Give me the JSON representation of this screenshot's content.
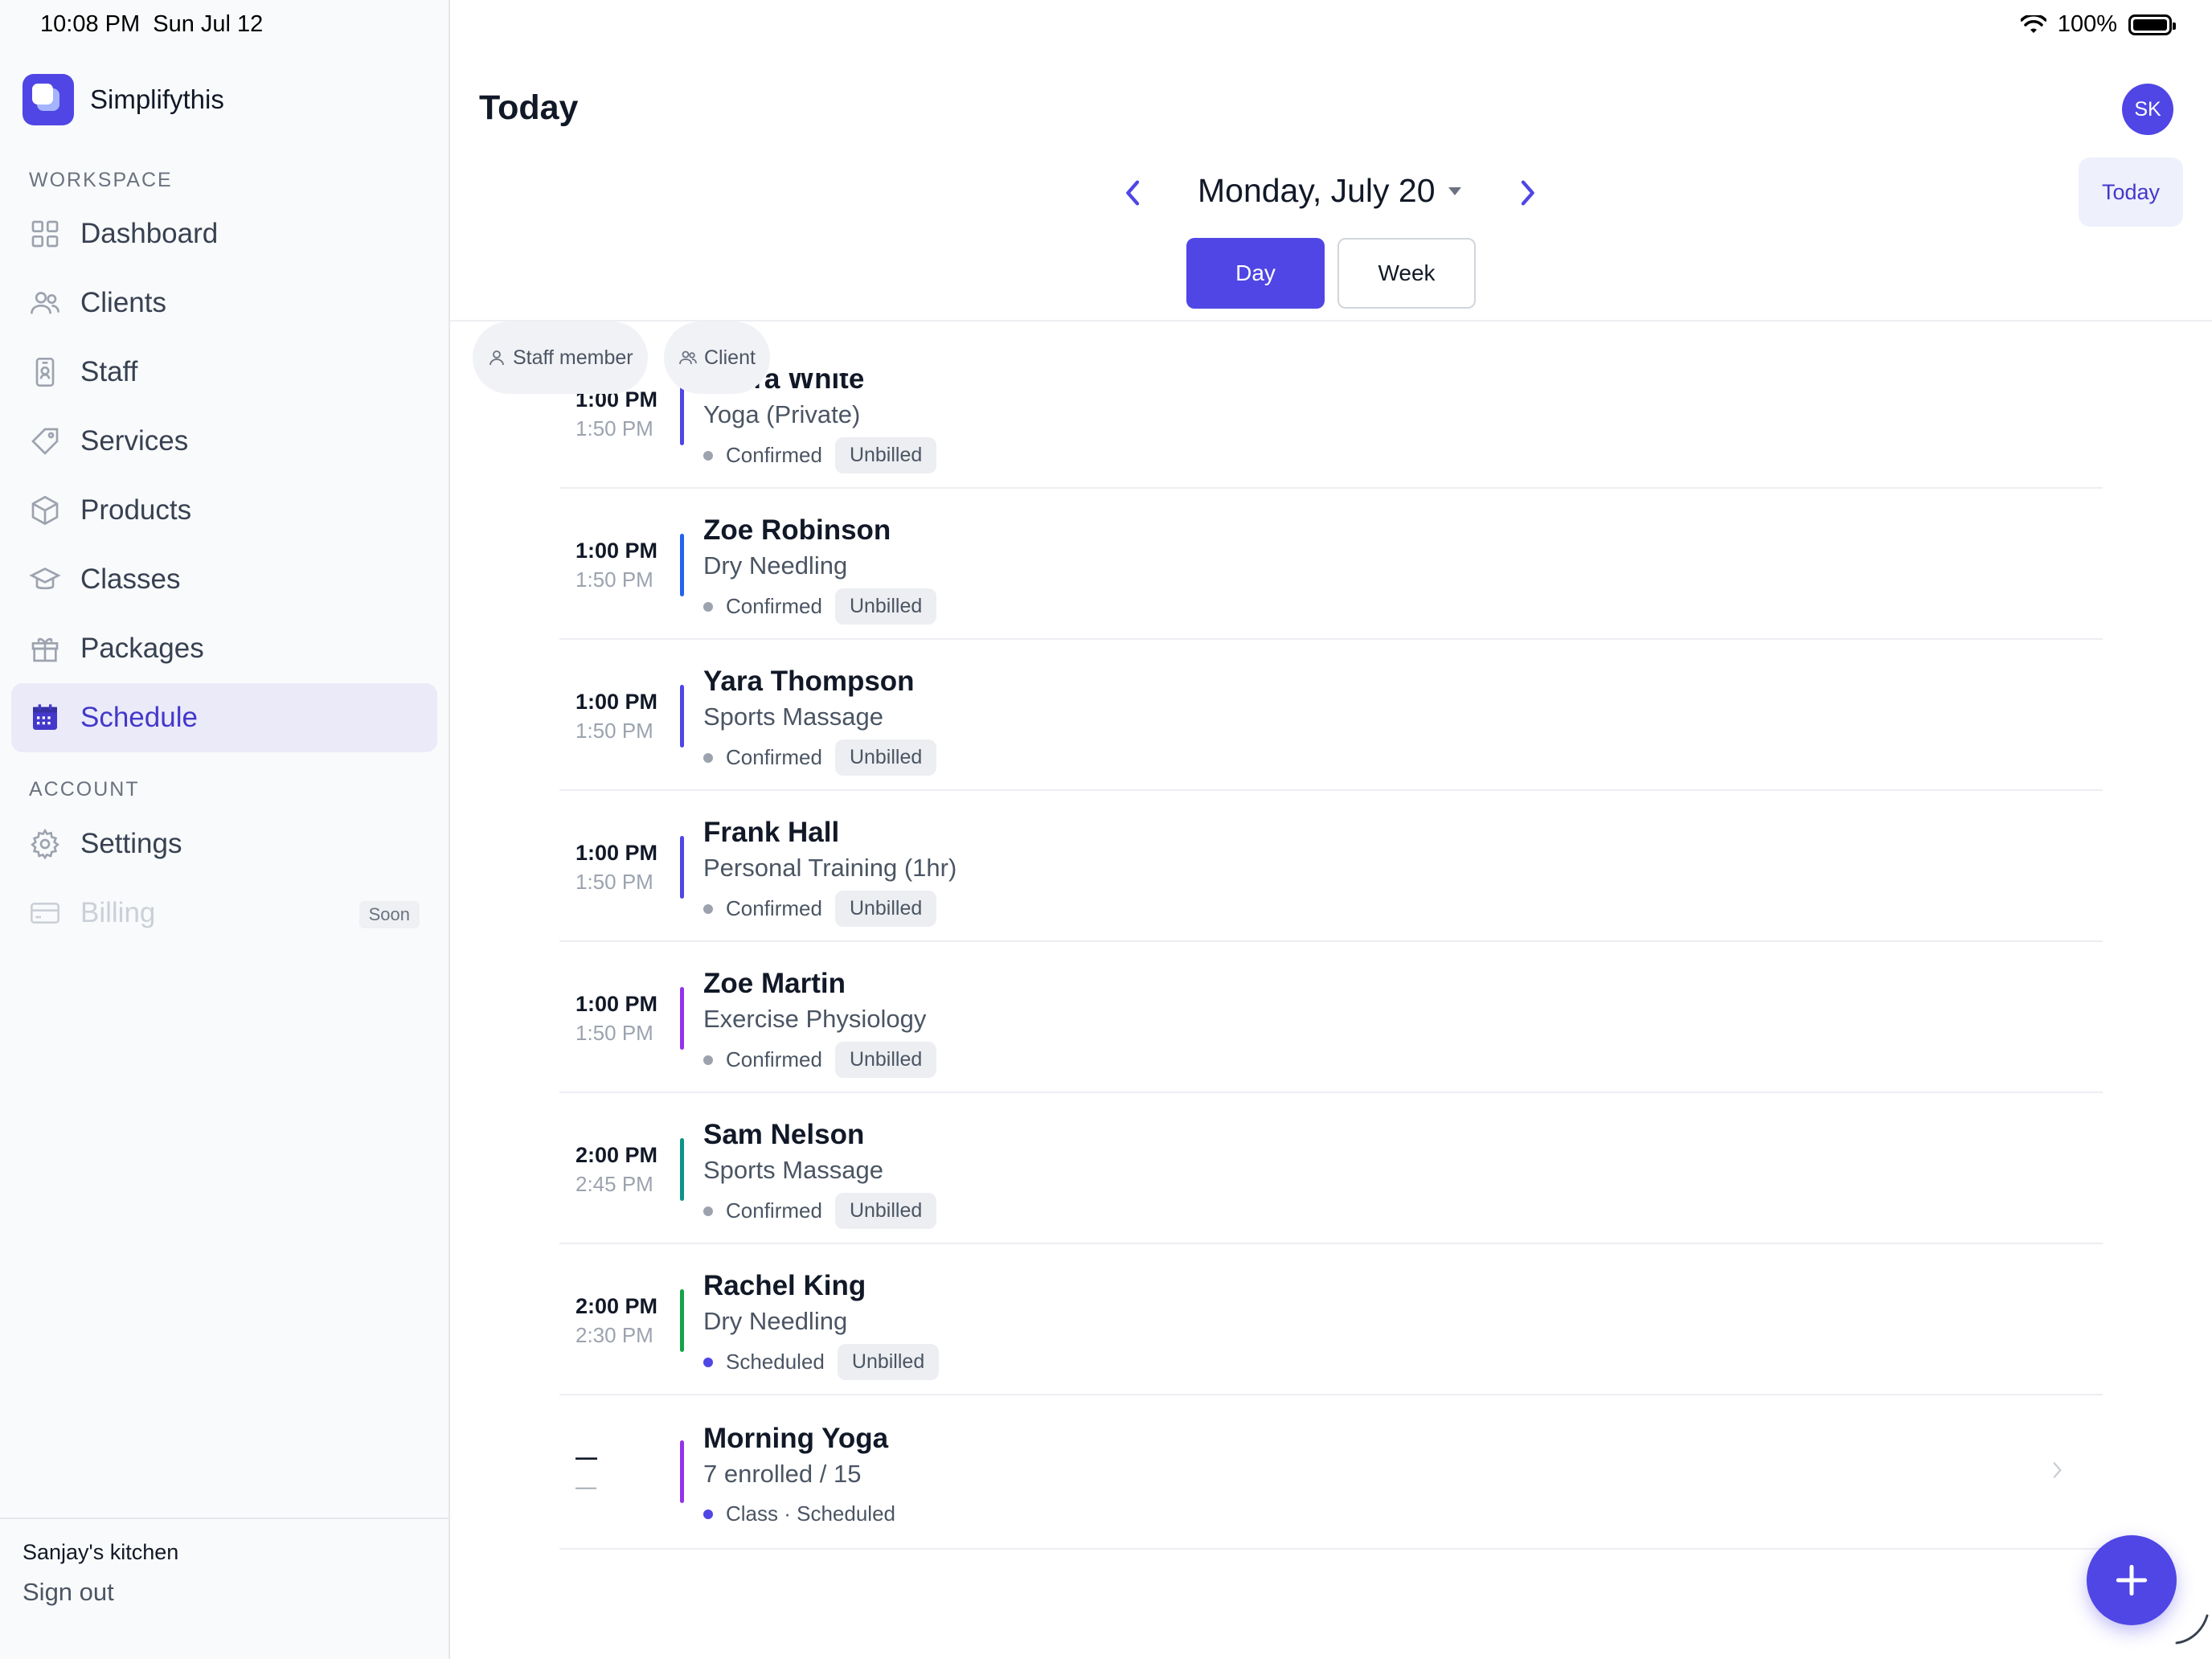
{
  "status_bar": {
    "time": "10:08 PM",
    "date": "Sun Jul 12",
    "battery": "100%"
  },
  "app": {
    "name": "Simplifythis"
  },
  "sidebar": {
    "workspace_label": "WORKSPACE",
    "account_label": "ACCOUNT",
    "items": [
      {
        "label": "Dashboard",
        "icon": "grid-icon"
      },
      {
        "label": "Clients",
        "icon": "users-icon"
      },
      {
        "label": "Staff",
        "icon": "id-badge-icon"
      },
      {
        "label": "Services",
        "icon": "tag-icon"
      },
      {
        "label": "Products",
        "icon": "box-icon"
      },
      {
        "label": "Classes",
        "icon": "graduation-cap-icon"
      },
      {
        "label": "Packages",
        "icon": "gift-icon"
      },
      {
        "label": "Schedule",
        "icon": "calendar-icon",
        "active": true
      }
    ],
    "account_items": [
      {
        "label": "Settings",
        "icon": "gear-icon"
      },
      {
        "label": "Billing",
        "icon": "credit-card-icon",
        "badge": "Soon",
        "disabled": true
      }
    ],
    "footer": {
      "workspace_name": "Sanjay's kitchen",
      "sign_out": "Sign out"
    }
  },
  "header": {
    "title": "Today",
    "avatar_initials": "SK",
    "date_label": "Monday, July 20",
    "today_button": "Today",
    "view_day": "Day",
    "view_week": "Week"
  },
  "filters": {
    "staff": "Staff member",
    "client": "Client"
  },
  "appointments": [
    {
      "start": "1:00 PM",
      "end": "1:50 PM",
      "name": "Laura White",
      "service": "Yoga (Private)",
      "status": "Confirmed",
      "billing": "Unbilled",
      "color": "#4f46e5",
      "dot": "#9ca3af"
    },
    {
      "start": "1:00 PM",
      "end": "1:50 PM",
      "name": "Zoe Robinson",
      "service": "Dry Needling",
      "status": "Confirmed",
      "billing": "Unbilled",
      "color": "#2563eb",
      "dot": "#9ca3af"
    },
    {
      "start": "1:00 PM",
      "end": "1:50 PM",
      "name": "Yara Thompson",
      "service": "Sports Massage",
      "status": "Confirmed",
      "billing": "Unbilled",
      "color": "#4f46e5",
      "dot": "#9ca3af"
    },
    {
      "start": "1:00 PM",
      "end": "1:50 PM",
      "name": "Frank Hall",
      "service": "Personal Training (1hr)",
      "status": "Confirmed",
      "billing": "Unbilled",
      "color": "#4f46e5",
      "dot": "#9ca3af"
    },
    {
      "start": "1:00 PM",
      "end": "1:50 PM",
      "name": "Zoe Martin",
      "service": "Exercise Physiology",
      "status": "Confirmed",
      "billing": "Unbilled",
      "color": "#9333ea",
      "dot": "#9ca3af"
    },
    {
      "start": "2:00 PM",
      "end": "2:45 PM",
      "name": "Sam Nelson",
      "service": "Sports Massage",
      "status": "Confirmed",
      "billing": "Unbilled",
      "color": "#0d9488",
      "dot": "#9ca3af"
    },
    {
      "start": "2:00 PM",
      "end": "2:30 PM",
      "name": "Rachel King",
      "service": "Dry Needling",
      "status": "Scheduled",
      "billing": "Unbilled",
      "color": "#16a34a",
      "dot": "#4f46e5"
    }
  ],
  "class_entry": {
    "start": "—",
    "end": "—",
    "name": "Morning Yoga",
    "enrolled": "7 enrolled / 15",
    "status": "Class · Scheduled",
    "color": "#9333ea",
    "dot": "#4f46e5"
  },
  "colors": {
    "accent": "#4f46e5",
    "active_bg": "#ebeaf9"
  }
}
